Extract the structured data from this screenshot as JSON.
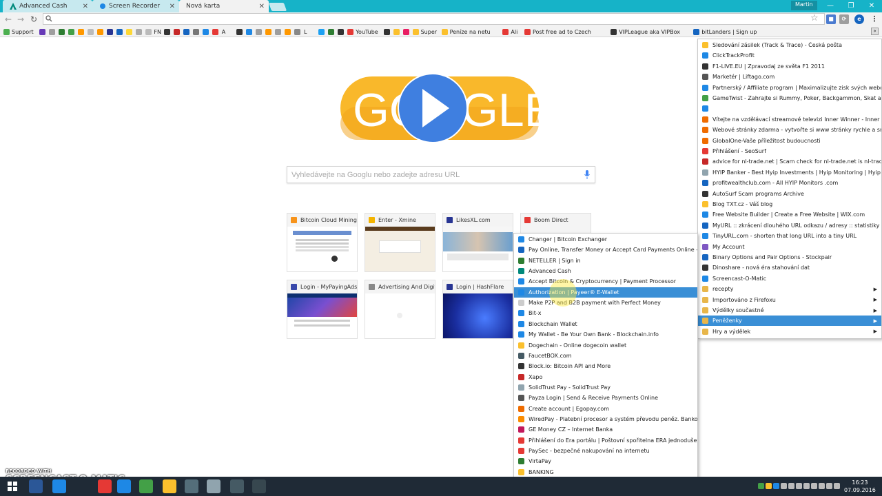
{
  "tabs": [
    {
      "title": "Advanced Cash",
      "icon": "advcash-icon",
      "active": false
    },
    {
      "title": "Screen Recorder",
      "icon": "screen-recorder-icon",
      "active": false
    },
    {
      "title": "Nová karta",
      "icon": "",
      "active": true
    }
  ],
  "profile_name": "Martin",
  "omnibox": {
    "value": "",
    "placeholder": ""
  },
  "bookmarks_bar": [
    {
      "label": "Support",
      "color": "#4caf50"
    },
    {
      "label": "",
      "color": "#673ab7"
    },
    {
      "label": "",
      "color": "#9e9e9e"
    },
    {
      "label": "",
      "color": "#2e7d32"
    },
    {
      "label": "",
      "color": "#43a047"
    },
    {
      "label": "",
      "color": "#ff9800"
    },
    {
      "label": "",
      "color": "#bbbbbb"
    },
    {
      "label": "",
      "color": "#ff9800"
    },
    {
      "label": "",
      "color": "#283593"
    },
    {
      "label": "",
      "color": "#1565c0"
    },
    {
      "label": "",
      "color": "#fdd835"
    },
    {
      "label": "",
      "color": "#aaaaaa"
    },
    {
      "label": "FN",
      "color": "#bbbbbb"
    },
    {
      "label": "",
      "color": "#333333"
    },
    {
      "label": "",
      "color": "#c62828"
    },
    {
      "label": "",
      "color": "#1565c0"
    },
    {
      "label": "",
      "color": "#777777"
    },
    {
      "label": "",
      "color": "#1e88e5"
    },
    {
      "label": "",
      "color": "#e53935"
    },
    {
      "label": "A",
      "color": "#ffffff"
    },
    {
      "label": "",
      "color": "#333333"
    },
    {
      "label": "",
      "color": "#1e88e5"
    },
    {
      "label": "",
      "color": "#9e9e9e"
    },
    {
      "label": "",
      "color": "#ff9800"
    },
    {
      "label": "",
      "color": "#9e9e9e"
    },
    {
      "label": "",
      "color": "#ff9800"
    },
    {
      "label": "",
      "color": "#888888"
    },
    {
      "label": "L",
      "color": "#ffffff"
    },
    {
      "label": "",
      "color": "#1da1f2"
    },
    {
      "label": "",
      "color": "#2e7d32"
    },
    {
      "label": "",
      "color": "#333333"
    },
    {
      "label": "YouTube",
      "color": "#e53935"
    },
    {
      "label": "",
      "color": "#333333"
    },
    {
      "label": "",
      "color": "#fbc02d"
    },
    {
      "label": "",
      "color": "#e91e63"
    },
    {
      "label": "Super",
      "color": "#fbc02d"
    },
    {
      "label": "Peníze na netu",
      "color": "#fbc02d"
    },
    {
      "label": "Ali",
      "color": "#e53935"
    },
    {
      "label": "Post free ad to Czech",
      "color": "#e53935"
    },
    {
      "label": "VIPLeague aka VIPBox",
      "color": "#333333"
    },
    {
      "label": "bitLanders | Sign up",
      "color": "#1565c0"
    }
  ],
  "search": {
    "placeholder": "Vyhledávejte na Googlu nebo zadejte adresu URL"
  },
  "doodle": {
    "letters_left": "GO",
    "letters_right": "GLE",
    "bg_color": "#f9b82b",
    "play_color": "#3f7fe0"
  },
  "tiles": [
    {
      "title": "Bitcoin Cloud Mining",
      "fav_color": "#f7931a"
    },
    {
      "title": "Enter - Xmine",
      "fav_color": "#f4b400"
    },
    {
      "title": "LikesXL.com",
      "fav_color": "#283593"
    },
    {
      "title": "Boom Direct",
      "fav_color": "#e53935"
    },
    {
      "title": "Login - MyPayingAds",
      "fav_color": "#3949ab"
    },
    {
      "title": "Advertising And Digital",
      "fav_color": "#888888"
    },
    {
      "title": "Login | HashFlare",
      "fav_color": "#283593"
    }
  ],
  "submenu": {
    "items": [
      {
        "label": "Changer | Bitcoin Exchanger",
        "icon_color": "#1e88e5"
      },
      {
        "label": "Pay Online, Transfer Money or Accept Card Payments Online -...",
        "icon_color": "#1565c0"
      },
      {
        "label": "NETELLER | Sign in",
        "icon_color": "#2e7d32"
      },
      {
        "label": "Advanced Cash",
        "icon_color": "#00897b"
      },
      {
        "label": "Accept Bitcoin & Cryptocurrency | Payment Processor",
        "icon_color": "#1e88e5"
      },
      {
        "label": "Authorization | Payeer® E-Wallet",
        "icon_color": "#1e88e5",
        "selected": true
      },
      {
        "label": "Make P2P and B2B payment with Perfect Money",
        "icon_color": "#cccccc"
      },
      {
        "label": "Bit-x",
        "icon_color": "#1e88e5"
      },
      {
        "label": "Blockchain Wallet",
        "icon_color": "#1e88e5"
      },
      {
        "label": "My Wallet - Be Your Own Bank - Blockchain.info",
        "icon_color": "#1e88e5"
      },
      {
        "label": "Dogechain - Online dogecoin wallet",
        "icon_color": "#fbc02d"
      },
      {
        "label": "FaucetBOX.com",
        "icon_color": "#455a64"
      },
      {
        "label": "Block.io: Bitcoin API and More",
        "icon_color": "#333333"
      },
      {
        "label": "Xapo",
        "icon_color": "#c62828"
      },
      {
        "label": "SolidTrust Pay - SolidTrust Pay",
        "icon_color": "#90a4ae"
      },
      {
        "label": "Payza Login | Send & Receive Payments Online",
        "icon_color": "#555555"
      },
      {
        "label": "Create account | Egopay.com",
        "icon_color": "#ef6c00"
      },
      {
        "label": "WiredPay - Platební procesor a systém převodu peněz. Bankov...",
        "icon_color": "#fb8c00"
      },
      {
        "label": "GE Money CZ – Internet Banka",
        "icon_color": "#c2185b"
      },
      {
        "label": "Přihlášení do Era portálu | Poštovní spořitelna ERA jednoduše",
        "icon_color": "#e53935"
      },
      {
        "label": "PaySec - bezpečné nakupování na internetu",
        "icon_color": "#e53935"
      },
      {
        "label": "VirtaPay",
        "icon_color": "#2e7d32"
      },
      {
        "label": "BANKING",
        "icon_color": "#fbc02d"
      }
    ]
  },
  "mainmenu": {
    "items": [
      {
        "label": "Sledování zásilek (Track & Trace) - Česká pošta",
        "icon_color": "#fbc02d"
      },
      {
        "label": "ClickTrackProfit",
        "icon_color": "#1e88e5"
      },
      {
        "label": "F1-LIVE.EU | Zpravodaj ze světa F1 2011",
        "icon_color": "#333333"
      },
      {
        "label": "Marketér | Liftago.com",
        "icon_color": "#555555"
      },
      {
        "label": "Partnerský / Affiliate program | Maximalizujte zisk svých webov...",
        "icon_color": "#1e88e5"
      },
      {
        "label": "GameTwist - Zahrajte si Rummy, Poker, Backgammon, Skat a mn...",
        "icon_color": "#43a047"
      },
      {
        "label": "",
        "icon_color": "#1e88e5"
      },
      {
        "label": "Vítejte na vzdělávací streamové televizi Inner Winner - Inner W...",
        "icon_color": "#ef6c00"
      },
      {
        "label": "Webové stránky zdarma - vytvořte si www stránky rychle a sna...",
        "icon_color": "#ef6c00"
      },
      {
        "label": "GlobalOne-Vaše příležitost budoucnosti",
        "icon_color": "#ef6c00"
      },
      {
        "label": "Přihlášení - SeoSurf",
        "icon_color": "#e53935"
      },
      {
        "label": "advice for nl-trade.net | Scam check for nl-trade.net is nl-trade...",
        "icon_color": "#c62828"
      },
      {
        "label": "HYIP Banker - Best Hyip Investments | Hyip Monitoring | Hyip ...",
        "icon_color": "#90a4ae"
      },
      {
        "label": "profitwealthclub.com - All HYIP Monitors .com",
        "icon_color": "#1565c0"
      },
      {
        "label": "AutoSurf Scam programs Archive",
        "icon_color": "#333333"
      },
      {
        "label": "Blog TXT.cz - Váš blog",
        "icon_color": "#fbc02d"
      },
      {
        "label": "Free Website Builder | Create a Free Website | WIX.com",
        "icon_color": "#1e88e5"
      },
      {
        "label": "MyURL :: zkrácení dlouhého URL odkazu / adresy :: statistiky :...",
        "icon_color": "#1565c0"
      },
      {
        "label": "TinyURL.com - shorten that long URL into a tiny URL",
        "icon_color": "#1e88e5"
      },
      {
        "label": "My Account",
        "icon_color": "#7e57c2"
      },
      {
        "label": "Binary Options and Pair Options - Stockpair",
        "icon_color": "#1565c0"
      },
      {
        "label": "Dinoshare - nová éra stahování dat",
        "icon_color": "#333333"
      },
      {
        "label": "Screencast-O-Matic",
        "icon_color": "#1e88e5"
      },
      {
        "label": "recepty",
        "folder": true
      },
      {
        "label": "Importováno z Firefoxu",
        "folder": true
      },
      {
        "label": "Výdělky součastné",
        "folder": true
      },
      {
        "label": "Peněženky",
        "folder": true,
        "selected": true
      },
      {
        "label": "Hry a výdělek",
        "folder": true
      }
    ]
  },
  "watermark": {
    "small": "RECORDED WITH",
    "big": "SCREENCAST-O-MATIC"
  },
  "taskbar": {
    "apps": [
      {
        "name": "file-manager-icon",
        "color": "#2b5797"
      },
      {
        "name": "screencast-icon",
        "color": "#1e88e5"
      },
      {
        "name": "app-icon",
        "color": "#e53935"
      },
      {
        "name": "edge-icon",
        "color": "#1e88e5"
      },
      {
        "name": "chrome-icon",
        "color": "#43a047"
      },
      {
        "name": "explorer-icon",
        "color": "#fbc02d"
      },
      {
        "name": "app-icon",
        "color": "#546e7a"
      },
      {
        "name": "app-icon",
        "color": "#90a4ae"
      },
      {
        "name": "calculator-icon",
        "color": "#455a64"
      },
      {
        "name": "snip-icon",
        "color": "#37474f"
      }
    ],
    "time": "16:23",
    "date": "07.09.2016"
  }
}
